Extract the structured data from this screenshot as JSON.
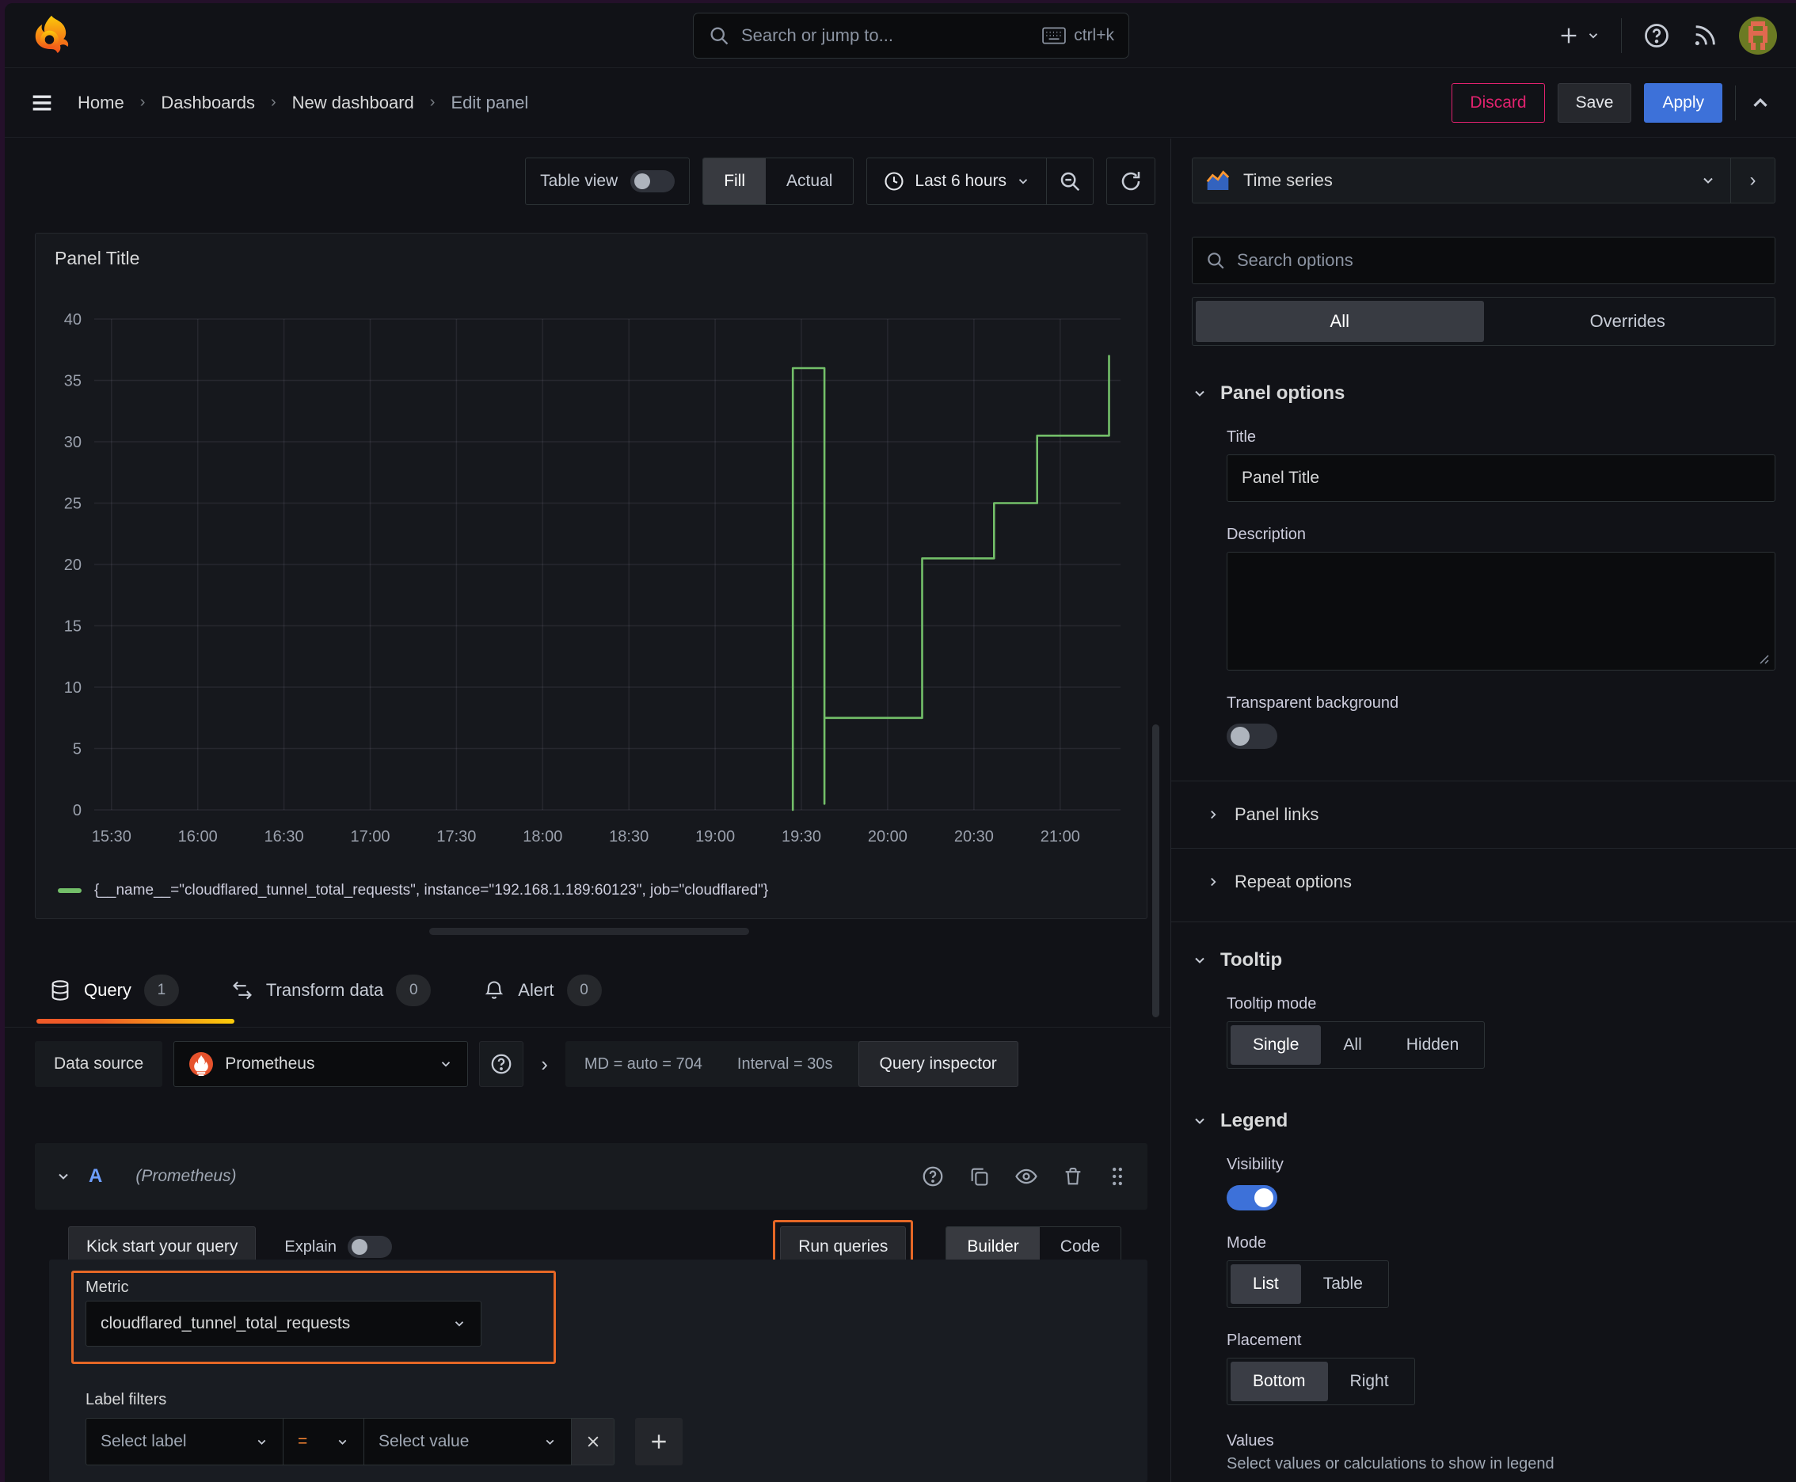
{
  "topbar": {
    "search_placeholder": "Search or jump to...",
    "search_shortcut": "ctrl+k"
  },
  "breadcrumb": {
    "items": [
      "Home",
      "Dashboards",
      "New dashboard",
      "Edit panel"
    ]
  },
  "actions": {
    "discard": "Discard",
    "save": "Save",
    "apply": "Apply"
  },
  "toolbar": {
    "table_view": "Table view",
    "fill": "Fill",
    "actual": "Actual",
    "time_range": "Last 6 hours"
  },
  "panel": {
    "title": "Panel Title"
  },
  "tabs": {
    "query": {
      "label": "Query",
      "count": "1"
    },
    "transform": {
      "label": "Transform data",
      "count": "0"
    },
    "alert": {
      "label": "Alert",
      "count": "0"
    }
  },
  "datasource": {
    "label": "Data source",
    "name": "Prometheus",
    "stats": "MD = auto = 704",
    "interval": "Interval = 30s",
    "inspector": "Query inspector"
  },
  "query_row": {
    "ref_id": "A",
    "ds_hint": "(Prometheus)"
  },
  "query_toolbar": {
    "kickstart": "Kick start your query",
    "explain": "Explain",
    "run": "Run queries",
    "builder": "Builder",
    "code": "Code"
  },
  "builder": {
    "metric_label": "Metric",
    "metric_value": "cloudflared_tunnel_total_requests",
    "label_filters": "Label filters",
    "select_label": "Select label",
    "operator": "=",
    "select_value": "Select value"
  },
  "options": {
    "viz_name": "Time series",
    "search_placeholder": "Search options",
    "tab_all": "All",
    "tab_overrides": "Overrides",
    "panel_options": {
      "title": "Panel options",
      "title_label": "Title",
      "title_value": "Panel Title",
      "description_label": "Description",
      "transparent_label": "Transparent background"
    },
    "panel_links": "Panel links",
    "repeat_options": "Repeat options",
    "tooltip": {
      "title": "Tooltip",
      "mode_label": "Tooltip mode",
      "single": "Single",
      "all": "All",
      "hidden": "Hidden"
    },
    "legend": {
      "title": "Legend",
      "visibility_label": "Visibility",
      "mode_label": "Mode",
      "list": "List",
      "table": "Table",
      "placement_label": "Placement",
      "bottom": "Bottom",
      "right": "Right",
      "values_label": "Values",
      "values_desc": "Select values or calculations to show in legend"
    }
  },
  "colors": {
    "accent_blue": "#3d71d9",
    "annotation_orange": "#e56726",
    "operator_orange": "#ff8833",
    "series_green": "#73bf69",
    "discard_red": "#e0226e"
  },
  "chart_data": {
    "type": "line",
    "title": "Panel Title",
    "xlabel": "",
    "ylabel": "",
    "ylim": [
      0,
      40
    ],
    "y_ticks": [
      0,
      5,
      10,
      15,
      20,
      25,
      30,
      35,
      40
    ],
    "x_ticks": [
      "15:30",
      "16:00",
      "16:30",
      "17:00",
      "17:30",
      "18:00",
      "18:30",
      "19:00",
      "19:30",
      "20:00",
      "20:30",
      "21:00"
    ],
    "x_domain": [
      "15:24",
      "21:21"
    ],
    "grid": true,
    "legend_position": "bottom",
    "series": [
      {
        "name": "{__name__=\"cloudflared_tunnel_total_requests\", instance=\"192.168.1.189:60123\", job=\"cloudflared\"}",
        "color": "#73bf69",
        "points": [
          [
            "19:27",
            0
          ],
          [
            "19:27",
            36
          ],
          [
            "19:38",
            36
          ],
          [
            "19:38",
            0.5
          ],
          [
            "19:38",
            7.5
          ],
          [
            "20:12",
            7.5
          ],
          [
            "20:12",
            20.5
          ],
          [
            "20:37",
            20.5
          ],
          [
            "20:37",
            25
          ],
          [
            "20:52",
            25
          ],
          [
            "20:52",
            30.5
          ],
          [
            "21:17",
            30.5
          ],
          [
            "21:17",
            37
          ]
        ]
      }
    ]
  }
}
